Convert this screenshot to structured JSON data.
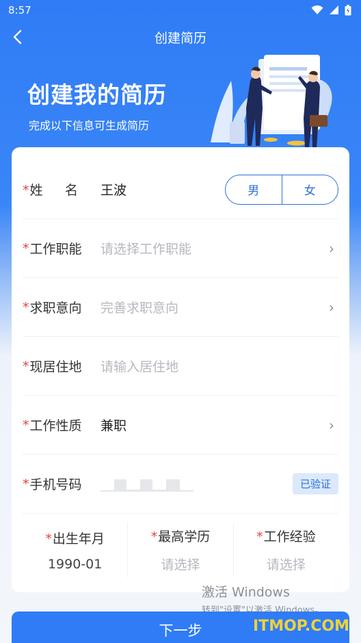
{
  "status_bar": {
    "time": "8:57"
  },
  "nav": {
    "title": "创建简历"
  },
  "hero": {
    "title": "创建我的简历",
    "subtitle": "完成以下信息可生成简历"
  },
  "form": {
    "required_mark": "*",
    "name": {
      "label_a": "姓",
      "label_b": "名",
      "value": "王波",
      "gender_male": "男",
      "gender_female": "女"
    },
    "job_function": {
      "label": "工作职能",
      "placeholder": "请选择工作职能"
    },
    "job_intention": {
      "label": "求职意向",
      "placeholder": "完善求职意向"
    },
    "residence": {
      "label": "现居住地",
      "placeholder": "请输入居住地"
    },
    "job_nature": {
      "label": "工作性质",
      "value": "兼职"
    },
    "phone": {
      "label": "手机号码",
      "verified": "已验证"
    },
    "birth": {
      "label": "出生年月",
      "value": "1990-01"
    },
    "education": {
      "label": "最高学历",
      "placeholder": "请选择"
    },
    "experience": {
      "label": "工作经验",
      "placeholder": "请选择"
    },
    "chevron": "›"
  },
  "watermark": {
    "line1": "激活 Windows",
    "line2": "转到\"设置\"以激活 Windows。"
  },
  "footer": {
    "next_label": "下一步",
    "site_logo": "ITMOP.COM"
  },
  "colors": {
    "primary": "#2f7cf6",
    "required": "#e8433a",
    "accent": "#2f6fd6"
  }
}
